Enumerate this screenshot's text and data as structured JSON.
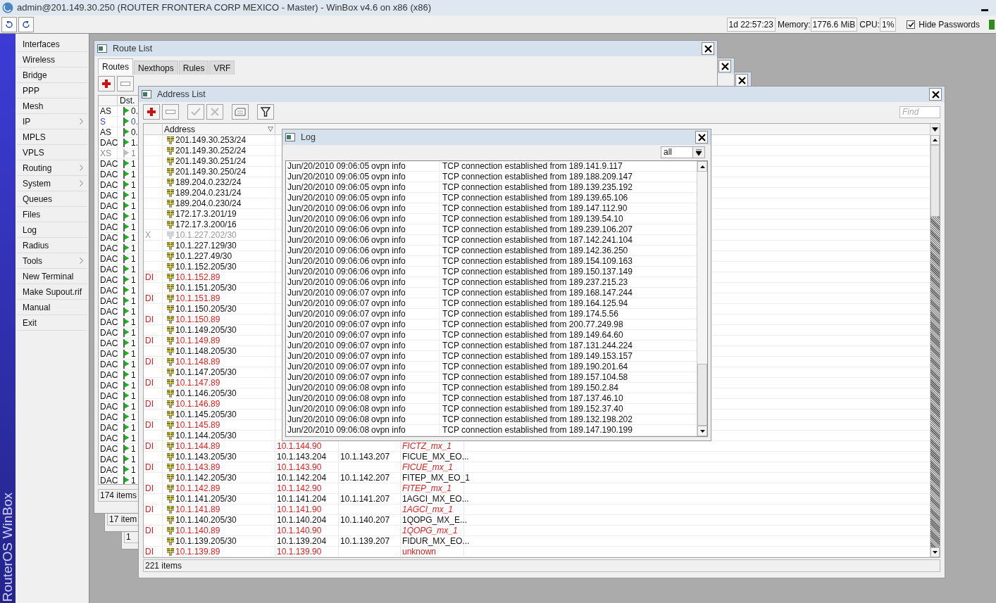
{
  "title_bar": {
    "title": "admin@201.149.30.250 (ROUTER FRONTERA CORP MEXICO - Master) - WinBox v4.6 on x86 (x86)"
  },
  "status": {
    "uptime": "1d 22:57:23",
    "memory_label": "Memory:",
    "memory": "1776.6 MiB",
    "cpu_label": "CPU:",
    "cpu": "1%",
    "hide_passwords": {
      "label": "Hide Passwords",
      "checked": true
    }
  },
  "side_banner": "RouterOS WinBox",
  "menu": [
    {
      "label": "Interfaces",
      "submenu": false
    },
    {
      "label": "Wireless",
      "submenu": false
    },
    {
      "label": "Bridge",
      "submenu": false
    },
    {
      "label": "PPP",
      "submenu": false
    },
    {
      "label": "Mesh",
      "submenu": false
    },
    {
      "label": "IP",
      "submenu": true
    },
    {
      "label": "MPLS",
      "submenu": false
    },
    {
      "label": "VPLS",
      "submenu": false
    },
    {
      "label": "Routing",
      "submenu": true
    },
    {
      "label": "System",
      "submenu": true
    },
    {
      "label": "Queues",
      "submenu": false
    },
    {
      "label": "Files",
      "submenu": false
    },
    {
      "label": "Log",
      "submenu": false
    },
    {
      "label": "Radius",
      "submenu": false
    },
    {
      "label": "Tools",
      "submenu": true
    },
    {
      "label": "New Terminal",
      "submenu": false
    },
    {
      "label": "Make Supout.rif",
      "submenu": false
    },
    {
      "label": "Manual",
      "submenu": false
    },
    {
      "label": "Exit",
      "submenu": false
    }
  ],
  "background_windows": [
    {
      "footer": "17 item"
    },
    {
      "footer": "1"
    }
  ],
  "route_list": {
    "title": "Route List",
    "tabs": [
      {
        "label": "Routes",
        "selected": true
      },
      {
        "label": "Nexthops",
        "selected": false
      },
      {
        "label": "Rules",
        "selected": false
      },
      {
        "label": "VRF",
        "selected": false
      }
    ],
    "dst_header": "Dst.",
    "rows": [
      {
        "flags": "AS",
        "dst": "0.",
        "kind": "active"
      },
      {
        "flags": "S",
        "dst": "0.",
        "kind": "static"
      },
      {
        "flags": "AS",
        "dst": "0.",
        "kind": "active"
      },
      {
        "flags": "DAC",
        "dst": "1.",
        "kind": "active"
      },
      {
        "flags": "XS",
        "dst": "1",
        "kind": "disabled"
      },
      {
        "flags": "DAC",
        "dst": "1",
        "kind": "active"
      },
      {
        "flags": "DAC",
        "dst": "1",
        "kind": "active"
      },
      {
        "flags": "DAC",
        "dst": "1",
        "kind": "active"
      },
      {
        "flags": "DAC",
        "dst": "1",
        "kind": "active"
      },
      {
        "flags": "DAC",
        "dst": "1",
        "kind": "active"
      },
      {
        "flags": "DAC",
        "dst": "1",
        "kind": "active"
      },
      {
        "flags": "DAC",
        "dst": "1",
        "kind": "active"
      },
      {
        "flags": "DAC",
        "dst": "1",
        "kind": "active"
      },
      {
        "flags": "DAC",
        "dst": "1",
        "kind": "active"
      },
      {
        "flags": "DAC",
        "dst": "1",
        "kind": "active"
      },
      {
        "flags": "DAC",
        "dst": "1",
        "kind": "active"
      },
      {
        "flags": "DAC",
        "dst": "1",
        "kind": "active"
      },
      {
        "flags": "DAC",
        "dst": "1",
        "kind": "active"
      },
      {
        "flags": "DAC",
        "dst": "1",
        "kind": "active"
      },
      {
        "flags": "DAC",
        "dst": "1",
        "kind": "active"
      },
      {
        "flags": "DAC",
        "dst": "1",
        "kind": "active"
      },
      {
        "flags": "DAC",
        "dst": "1",
        "kind": "active"
      },
      {
        "flags": "DAC",
        "dst": "1",
        "kind": "active"
      },
      {
        "flags": "DAC",
        "dst": "1",
        "kind": "active"
      },
      {
        "flags": "DAC",
        "dst": "1",
        "kind": "active"
      },
      {
        "flags": "DAC",
        "dst": "1",
        "kind": "active"
      },
      {
        "flags": "DAC",
        "dst": "1",
        "kind": "active"
      },
      {
        "flags": "DAC",
        "dst": "1",
        "kind": "active"
      },
      {
        "flags": "DAC",
        "dst": "1",
        "kind": "active"
      },
      {
        "flags": "DAC",
        "dst": "1",
        "kind": "active"
      },
      {
        "flags": "DAC",
        "dst": "1",
        "kind": "active"
      },
      {
        "flags": "DAC",
        "dst": "1",
        "kind": "active"
      },
      {
        "flags": "DAC",
        "dst": "1",
        "kind": "active"
      },
      {
        "flags": "DAC",
        "dst": "1",
        "kind": "active"
      },
      {
        "flags": "DAC",
        "dst": "1",
        "kind": "active"
      },
      {
        "flags": "DAC",
        "dst": "1",
        "kind": "active"
      }
    ],
    "footer": "174 items"
  },
  "address_list": {
    "title": "Address List",
    "find_placeholder": "Find",
    "address_header": "Address",
    "rows": [
      {
        "flags": "",
        "address": "201.149.30.253/24",
        "kind": "normal"
      },
      {
        "flags": "",
        "address": "201.149.30.252/24",
        "kind": "normal"
      },
      {
        "flags": "",
        "address": "201.149.30.251/24",
        "kind": "normal"
      },
      {
        "flags": "",
        "address": "201.149.30.250/24",
        "kind": "normal"
      },
      {
        "flags": "",
        "address": "189.204.0.232/24",
        "kind": "normal"
      },
      {
        "flags": "",
        "address": "189.204.0.231/24",
        "kind": "normal"
      },
      {
        "flags": "",
        "address": "189.204.0.230/24",
        "kind": "normal"
      },
      {
        "flags": "",
        "address": "172.17.3.201/19",
        "kind": "normal"
      },
      {
        "flags": "",
        "address": "172.17.3.200/16",
        "kind": "normal"
      },
      {
        "flags": "X",
        "address": "10.1.227.202/30",
        "kind": "disabled"
      },
      {
        "flags": "",
        "address": "10.1.227.129/30",
        "kind": "normal"
      },
      {
        "flags": "",
        "address": "10.1.227.49/30",
        "kind": "normal"
      },
      {
        "flags": "",
        "address": "10.1.152.205/30",
        "kind": "normal"
      },
      {
        "flags": "DI",
        "address": "10.1.152.89",
        "kind": "dynamic"
      },
      {
        "flags": "",
        "address": "10.1.151.205/30",
        "kind": "normal"
      },
      {
        "flags": "DI",
        "address": "10.1.151.89",
        "kind": "dynamic"
      },
      {
        "flags": "",
        "address": "10.1.150.205/30",
        "kind": "normal"
      },
      {
        "flags": "DI",
        "address": "10.1.150.89",
        "kind": "dynamic"
      },
      {
        "flags": "",
        "address": "10.1.149.205/30",
        "kind": "normal"
      },
      {
        "flags": "DI",
        "address": "10.1.149.89",
        "kind": "dynamic"
      },
      {
        "flags": "",
        "address": "10.1.148.205/30",
        "kind": "normal"
      },
      {
        "flags": "DI",
        "address": "10.1.148.89",
        "kind": "dynamic"
      },
      {
        "flags": "",
        "address": "10.1.147.205/30",
        "kind": "normal"
      },
      {
        "flags": "DI",
        "address": "10.1.147.89",
        "kind": "dynamic"
      },
      {
        "flags": "",
        "address": "10.1.146.205/30",
        "kind": "normal"
      },
      {
        "flags": "DI",
        "address": "10.1.146.89",
        "kind": "dynamic"
      },
      {
        "flags": "",
        "address": "10.1.145.205/30",
        "kind": "normal"
      },
      {
        "flags": "DI",
        "address": "10.1.145.89",
        "kind": "dynamic"
      },
      {
        "flags": "",
        "address": "10.1.144.205/30",
        "kind": "normal"
      },
      {
        "flags": "DI",
        "address": "10.1.144.89",
        "kind": "dynamic",
        "network": "10.1.144.90",
        "interface": {
          "text": "FICTZ_mx_1",
          "italic": true
        }
      },
      {
        "flags": "",
        "address": "10.1.143.205/30",
        "kind": "normal",
        "network": "10.1.143.204",
        "broadcast": "10.1.143.207",
        "interface": {
          "text": "FICUE_MX_EO...",
          "italic": false
        }
      },
      {
        "flags": "DI",
        "address": "10.1.143.89",
        "kind": "dynamic",
        "network": "10.1.143.90",
        "interface": {
          "text": "FICUE_mx_1",
          "italic": true
        }
      },
      {
        "flags": "",
        "address": "10.1.142.205/30",
        "kind": "normal",
        "network": "10.1.142.204",
        "broadcast": "10.1.142.207",
        "interface": {
          "text": "FITEP_MX_EO_1",
          "italic": false
        }
      },
      {
        "flags": "DI",
        "address": "10.1.142.89",
        "kind": "dynamic",
        "network": "10.1.142.90",
        "interface": {
          "text": "FITEP_mx_1",
          "italic": true
        }
      },
      {
        "flags": "",
        "address": "10.1.141.205/30",
        "kind": "normal",
        "network": "10.1.141.204",
        "broadcast": "10.1.141.207",
        "interface": {
          "text": "1AGCI_MX_EO...",
          "italic": false
        }
      },
      {
        "flags": "DI",
        "address": "10.1.141.89",
        "kind": "dynamic",
        "network": "10.1.141.90",
        "interface": {
          "text": "1AGCI_mx_1",
          "italic": true
        }
      },
      {
        "flags": "",
        "address": "10.1.140.205/30",
        "kind": "normal",
        "network": "10.1.140.204",
        "broadcast": "10.1.140.207",
        "interface": {
          "text": "1QOPG_MX_E...",
          "italic": false
        }
      },
      {
        "flags": "DI",
        "address": "10.1.140.89",
        "kind": "dynamic",
        "network": "10.1.140.90",
        "interface": {
          "text": "1QOPG_mx_1",
          "italic": true
        }
      },
      {
        "flags": "",
        "address": "10.1.139.205/30",
        "kind": "normal",
        "network": "10.1.139.204",
        "broadcast": "10.1.139.207",
        "interface": {
          "text": "FIDUR_MX_EO...",
          "italic": false
        }
      },
      {
        "flags": "DI",
        "address": "10.1.139.89",
        "kind": "dynamic",
        "network": "10.1.139.90",
        "interface": {
          "text": "unknown",
          "italic": false
        }
      }
    ],
    "footer": "221 items"
  },
  "log": {
    "title": "Log",
    "filter": "all",
    "rows": [
      {
        "time": "Jun/20/2010 09:06:05",
        "topics": "ovpn info",
        "message": "TCP connection established from 189.141.9.117"
      },
      {
        "time": "Jun/20/2010 09:06:05",
        "topics": "ovpn info",
        "message": "TCP connection established from 189.188.209.147"
      },
      {
        "time": "Jun/20/2010 09:06:05",
        "topics": "ovpn info",
        "message": "TCP connection established from 189.139.235.192"
      },
      {
        "time": "Jun/20/2010 09:06:05",
        "topics": "ovpn info",
        "message": "TCP connection established from 189.139.65.106"
      },
      {
        "time": "Jun/20/2010 09:06:06",
        "topics": "ovpn info",
        "message": "TCP connection established from 189.147.112.90"
      },
      {
        "time": "Jun/20/2010 09:06:06",
        "topics": "ovpn info",
        "message": "TCP connection established from 189.139.54.10"
      },
      {
        "time": "Jun/20/2010 09:06:06",
        "topics": "ovpn info",
        "message": "TCP connection established from 189.239.106.207"
      },
      {
        "time": "Jun/20/2010 09:06:06",
        "topics": "ovpn info",
        "message": "TCP connection established from 187.142.241.104"
      },
      {
        "time": "Jun/20/2010 09:06:06",
        "topics": "ovpn info",
        "message": "TCP connection established from 189.142.36.250"
      },
      {
        "time": "Jun/20/2010 09:06:06",
        "topics": "ovpn info",
        "message": "TCP connection established from 189.154.109.163"
      },
      {
        "time": "Jun/20/2010 09:06:06",
        "topics": "ovpn info",
        "message": "TCP connection established from 189.150.137.149"
      },
      {
        "time": "Jun/20/2010 09:06:06",
        "topics": "ovpn info",
        "message": "TCP connection established from 189.237.215.23"
      },
      {
        "time": "Jun/20/2010 09:06:07",
        "topics": "ovpn info",
        "message": "TCP connection established from 189.168.147.244"
      },
      {
        "time": "Jun/20/2010 09:06:07",
        "topics": "ovpn info",
        "message": "TCP connection established from 189.164.125.94"
      },
      {
        "time": "Jun/20/2010 09:06:07",
        "topics": "ovpn info",
        "message": "TCP connection established from 189.174.5.56"
      },
      {
        "time": "Jun/20/2010 09:06:07",
        "topics": "ovpn info",
        "message": "TCP connection established from 200.77.249.98"
      },
      {
        "time": "Jun/20/2010 09:06:07",
        "topics": "ovpn info",
        "message": "TCP connection established from 189.149.64.60"
      },
      {
        "time": "Jun/20/2010 09:06:07",
        "topics": "ovpn info",
        "message": "TCP connection established from 187.131.244.224"
      },
      {
        "time": "Jun/20/2010 09:06:07",
        "topics": "ovpn info",
        "message": "TCP connection established from 189.149.153.157"
      },
      {
        "time": "Jun/20/2010 09:06:07",
        "topics": "ovpn info",
        "message": "TCP connection established from 189.190.201.64"
      },
      {
        "time": "Jun/20/2010 09:06:07",
        "topics": "ovpn info",
        "message": "TCP connection established from 189.157.104.58"
      },
      {
        "time": "Jun/20/2010 09:06:08",
        "topics": "ovpn info",
        "message": "TCP connection established from 189.150.2.84"
      },
      {
        "time": "Jun/20/2010 09:06:08",
        "topics": "ovpn info",
        "message": "TCP connection established from 187.137.46.10"
      },
      {
        "time": "Jun/20/2010 09:06:08",
        "topics": "ovpn info",
        "message": "TCP connection established from 189.152.37.40"
      },
      {
        "time": "Jun/20/2010 09:06:08",
        "topics": "ovpn info",
        "message": "TCP connection established from 189.132.198.202"
      },
      {
        "time": "Jun/20/2010 09:06:08",
        "topics": "ovpn info",
        "message": "TCP connection established from 189.147.190.199"
      }
    ]
  }
}
